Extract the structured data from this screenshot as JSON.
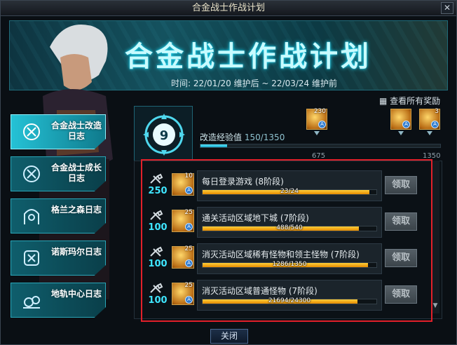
{
  "window": {
    "title": "合金战士作战计划"
  },
  "banner": {
    "title": "合金战士作战计划",
    "period": "时间: 22/01/20 维护后 ~ 22/03/24 维护前"
  },
  "sidebar": {
    "items": [
      {
        "label": "合金战士改造日志"
      },
      {
        "label": "合金战士成长日志"
      },
      {
        "label": "格兰之森日志"
      },
      {
        "label": "诺斯玛尔日志"
      },
      {
        "label": "地轨中心日志"
      }
    ]
  },
  "level": {
    "value": "9"
  },
  "view_all_rewards": "查看所有奖励",
  "xp": {
    "label": "改造经验值",
    "value_text": "150/1350",
    "fill_fraction": 0.11,
    "tick_675": "675",
    "tick_1350": "1350"
  },
  "milestone_rewards": [
    {
      "qty": "230",
      "badge": "A"
    },
    {
      "qty": "",
      "badge": "A"
    },
    {
      "qty": "3",
      "badge": "A"
    }
  ],
  "quests": [
    {
      "points": "250",
      "reward_qty": "10",
      "name": "每日登录游戏 (8阶段)",
      "progress_text": "23/24",
      "fill_fraction": 0.96,
      "claim_label": "领取"
    },
    {
      "points": "100",
      "reward_qty": "25",
      "name": "通关活动区域地下城 (7阶段)",
      "progress_text": "488/540",
      "fill_fraction": 0.9,
      "claim_label": "领取"
    },
    {
      "points": "100",
      "reward_qty": "25",
      "name": "消灭活动区域稀有怪物和领主怪物 (7阶段)",
      "progress_text": "1286/1350",
      "fill_fraction": 0.95,
      "claim_label": "领取"
    },
    {
      "points": "100",
      "reward_qty": "25",
      "name": "消灭活动区域普通怪物 (7阶段)",
      "progress_text": "21694/24300",
      "fill_fraction": 0.89,
      "claim_label": "领取"
    }
  ],
  "footer": {
    "close_label": "关闭"
  },
  "colors": {
    "accent": "#25c2d6",
    "progress": "#f5a800",
    "highlight_box": "#e2202a"
  }
}
